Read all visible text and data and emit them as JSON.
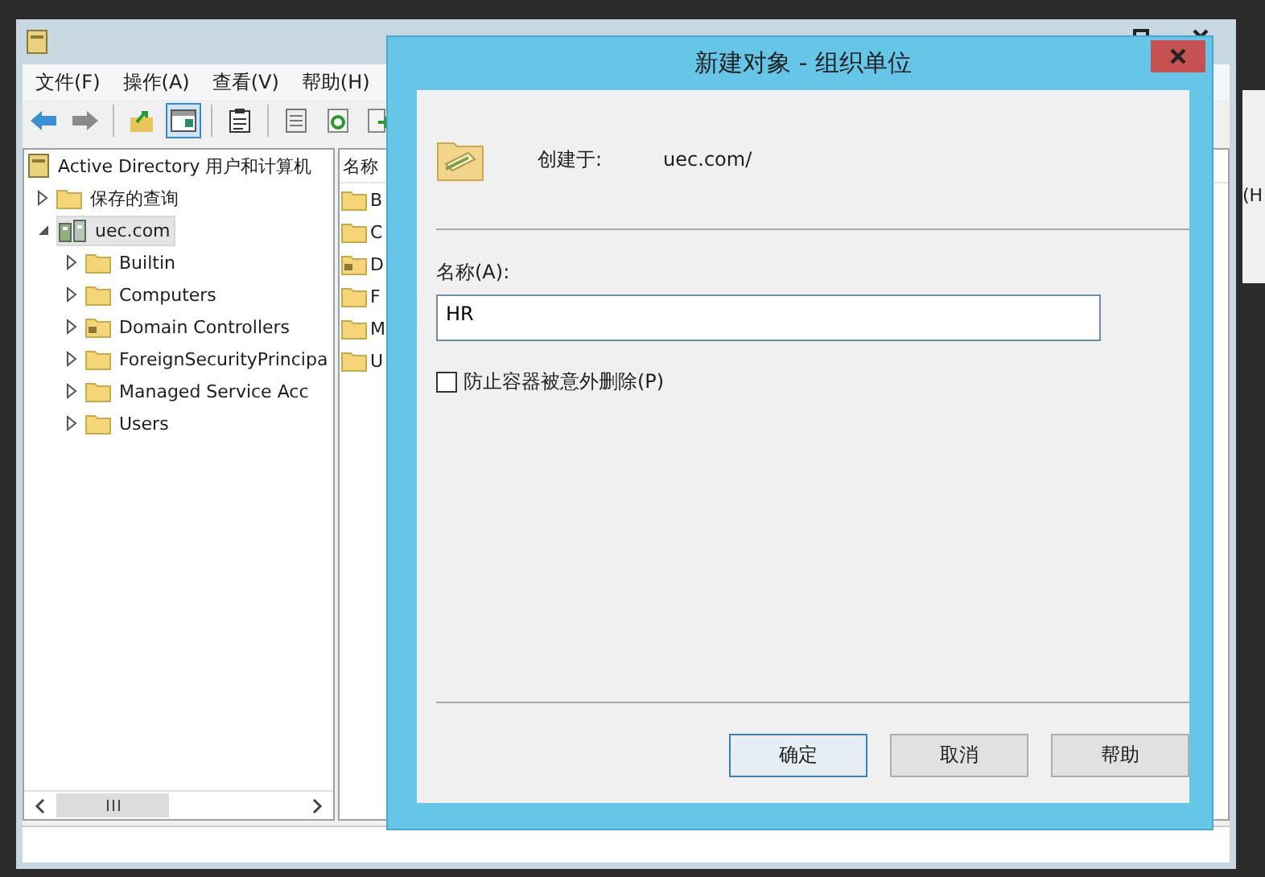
{
  "main_window": {
    "menu": [
      "文件(F)",
      "操作(A)",
      "查看(V)",
      "帮助(H)"
    ],
    "toolbar": [
      [
        {
          "kind": "back",
          "on": false
        },
        {
          "kind": "forward",
          "on": false
        }
      ],
      [
        {
          "kind": "up",
          "on": false
        },
        {
          "kind": "tree",
          "on": true
        }
      ],
      [
        {
          "kind": "clipboard",
          "on": false
        }
      ],
      [
        {
          "kind": "properties",
          "on": false
        },
        {
          "kind": "refresh",
          "on": false
        },
        {
          "kind": "export",
          "on": false
        }
      ]
    ],
    "tree": {
      "root": "Active Directory 用户和计算机",
      "items": [
        {
          "label": "保存的查询",
          "kind": "folder",
          "expanded": false,
          "selected": false
        },
        {
          "label": "uec.com",
          "kind": "domain",
          "expanded": true,
          "selected": true,
          "children": [
            {
              "label": "Builtin",
              "kind": "folder",
              "expanded": false,
              "selected": false
            },
            {
              "label": "Computers",
              "kind": "folder",
              "expanded": false,
              "selected": false
            },
            {
              "label": "Domain Controllers",
              "kind": "ou",
              "expanded": false,
              "selected": false
            },
            {
              "label": "ForeignSecurityPrincipa",
              "kind": "folder",
              "expanded": false,
              "selected": false
            },
            {
              "label": "Managed Service Acc",
              "kind": "folder",
              "expanded": false,
              "selected": false
            },
            {
              "label": "Users",
              "kind": "folder",
              "expanded": false,
              "selected": false
            }
          ]
        }
      ]
    },
    "list": {
      "column_1": "名称",
      "items": [
        {
          "label": "B",
          "kind": "folder"
        },
        {
          "label": "C",
          "kind": "folder"
        },
        {
          "label": "D",
          "kind": "ou"
        },
        {
          "label": "F",
          "kind": "folder"
        },
        {
          "label": "M",
          "kind": "folder"
        },
        {
          "label": "U",
          "kind": "folder"
        }
      ]
    }
  },
  "side_window": {
    "text": "(H"
  },
  "dialog": {
    "title": "新建对象 - 组织单位",
    "created_in_label": "创建于:",
    "created_in_value": "uec.com/",
    "name_label": "名称(A):",
    "name_value": "HR",
    "protect_checkbox": {
      "label": "防止容器被意外删除(P)",
      "checked": false
    },
    "buttons": [
      {
        "label": "确定",
        "default": true
      },
      {
        "label": "取消",
        "default": false
      },
      {
        "label": "帮助",
        "default": false
      }
    ]
  }
}
